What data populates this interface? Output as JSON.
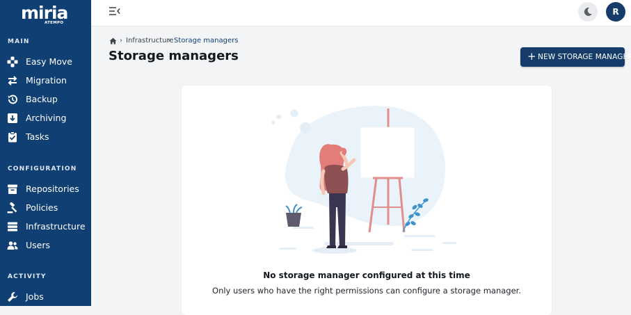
{
  "brand": {
    "logo_text": "miria",
    "logo_sub": "ATEMPO"
  },
  "sidebar": {
    "sections": [
      {
        "title": "MAIN",
        "items": [
          {
            "label": "Easy Move",
            "icon": "gamepad-icon"
          },
          {
            "label": "Migration",
            "icon": "arrows-swap-icon"
          },
          {
            "label": "Backup",
            "icon": "history-icon"
          },
          {
            "label": "Archiving",
            "icon": "archive-box-icon"
          },
          {
            "label": "Tasks",
            "icon": "clipboard-check-icon"
          }
        ]
      },
      {
        "title": "CONFIGURATION",
        "items": [
          {
            "label": "Repositories",
            "icon": "repository-icon"
          },
          {
            "label": "Policies",
            "icon": "gavel-icon"
          },
          {
            "label": "Infrastructure",
            "icon": "server-stack-icon"
          },
          {
            "label": "Users",
            "icon": "users-icon"
          }
        ]
      },
      {
        "title": "ACTIVITY",
        "items": [
          {
            "label": "Jobs",
            "icon": "wrench-icon"
          }
        ]
      }
    ]
  },
  "topbar": {
    "avatar_initial": "R",
    "theme_icon": "moon-icon",
    "menu_icon": "menu-collapse-icon"
  },
  "breadcrumb": {
    "home_icon": "home-icon",
    "items": [
      "Infrastructure",
      "Storage managers"
    ]
  },
  "page": {
    "title": "Storage managers",
    "new_button_label": "NEW STORAGE MANAGER"
  },
  "empty_state": {
    "title": "No storage manager configured at this time",
    "description": "Only users who have the right permissions can configure a storage manager."
  },
  "colors": {
    "sidebar_bg": "#0f3f73",
    "primary": "#163d6a",
    "accent_pink": "#e27d7a",
    "accent_blue": "#3e92cc"
  }
}
